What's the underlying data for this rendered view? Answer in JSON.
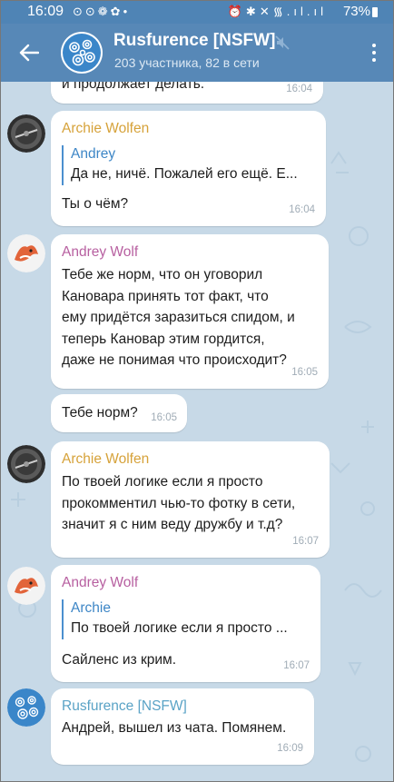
{
  "status_bar": {
    "time": "16:09",
    "left_icons": "⊙⊙❁✿•",
    "right_icons": "⏰✱✕᯾.ıl.ıl",
    "battery": "73%"
  },
  "header": {
    "title": "Rusfurence [NSFW]",
    "subtitle": "203 участника, 82 в сети"
  },
  "colors": {
    "header_bg": "#5788b7",
    "chat_bg": "#c7d9e7",
    "archie_name": "#d6a23a",
    "andrey_name": "#b75fa0",
    "group_name": "#5aa3c6",
    "reply_accent": "#4b8fcf"
  },
  "messages": [
    {
      "text": "и продолжает делать.",
      "time": "16:04"
    },
    {
      "sender": "Archie Wolfen",
      "reply_name": "Andrey",
      "reply_text": "Да не, ничё. Пожалей его ещё. Е...",
      "text": "Ты о чём?",
      "time": "16:04"
    },
    {
      "sender": "Andrey Wolf",
      "text": "Тебе же норм, что он уговорил\nКановара принять тот факт, что\nему придётся заразиться спидом, и\nтеперь Кановар этим гордится,\nдаже не понимая что происходит?",
      "time": "16:05"
    },
    {
      "text": "Тебе норм?",
      "time": "16:05"
    },
    {
      "sender": "Archie Wolfen",
      "text": "По твоей логике если я просто\nпрокомментил чью-то фотку в сети,\nзначит я с ним веду дружбу и т.д?",
      "time": "16:07"
    },
    {
      "sender": "Andrey Wolf",
      "reply_name": "Archie",
      "reply_text": "По твоей логике если я просто ...",
      "text": "Сайленс из крим.",
      "time": "16:07"
    },
    {
      "sender": "Rusfurence [NSFW]",
      "text": "Андрей, вышел из чата. Помянем.",
      "time": "16:09"
    }
  ]
}
